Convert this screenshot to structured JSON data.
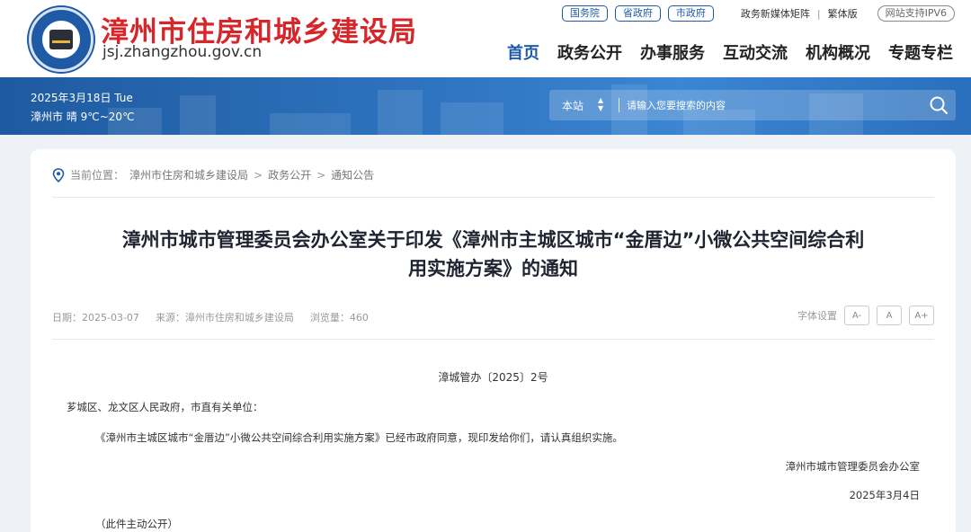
{
  "header": {
    "title": "漳州市住房和城乡建设局",
    "domain": "jsj.zhangzhou.gov.cn",
    "top_links": [
      "国务院",
      "省政府",
      "市政府"
    ],
    "media_link": "政务新媒体矩阵",
    "traditional_link": "繁体版",
    "ipv6_badge": "网站支持IPV6",
    "nav": [
      "首页",
      "政务公开",
      "办事服务",
      "互动交流",
      "机构概况",
      "专题专栏"
    ],
    "active_nav": "首页"
  },
  "banner": {
    "date": "2025年3月18日 Tue",
    "weather": "漳州市  晴 9℃~20℃",
    "search": {
      "scope": "本站",
      "placeholder": "请输入您要搜索的内容"
    }
  },
  "breadcrumb": {
    "prefix": "当前位置：",
    "items": [
      "漳州市住房和城乡建设局",
      "政务公开",
      "通知公告"
    ],
    "separator": ">"
  },
  "article": {
    "title_line1": "漳州市城市管理委员会办公室关于印发《漳州市主城区城市“金厝边”小微公共空间综合利",
    "title_line2": "用实施方案》的通知",
    "date": "日期：2025-03-07",
    "source": "来源：漳州市住房和城乡建设局",
    "views": "浏览量：460",
    "font_setting_label": "字体设置",
    "font_buttons": [
      "A-",
      "A",
      "A+"
    ],
    "doc_number": "漳城管办〔2025〕2号",
    "salutation": "芗城区、龙文区人民政府，市直有关单位：",
    "body": "《漳州市主城区城市“金厝边”小微公共空间综合利用实施方案》已经市政府同意，现印发给你们，请认真组织实施。",
    "signature": "漳州市城市管理委员会办公室",
    "sign_date": "2025年3月4日",
    "note": "（此件主动公开）"
  },
  "colors": {
    "brand_red": "#d6262a",
    "brand_blue": "#1f5aa6",
    "banner_blue": "#2f74c0"
  }
}
